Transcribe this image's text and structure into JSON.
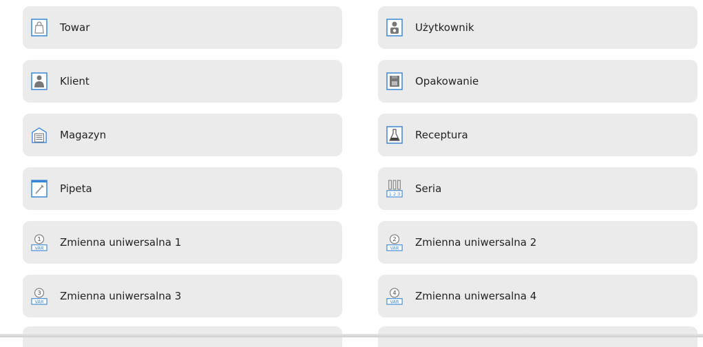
{
  "tiles": [
    {
      "label": "Towar",
      "icon": "shopping-bag-icon"
    },
    {
      "label": "Użytkownik",
      "icon": "user-icon"
    },
    {
      "label": "Klient",
      "icon": "client-icon"
    },
    {
      "label": "Opakowanie",
      "icon": "packaging-icon"
    },
    {
      "label": "Magazyn",
      "icon": "warehouse-icon"
    },
    {
      "label": "Receptura",
      "icon": "flask-icon"
    },
    {
      "label": "Pipeta",
      "icon": "pipette-icon"
    },
    {
      "label": "Seria",
      "icon": "series-icon"
    },
    {
      "label": "Zmienna uniwersalna 1",
      "icon": "variable-1-icon"
    },
    {
      "label": "Zmienna uniwersalna 2",
      "icon": "variable-2-icon"
    },
    {
      "label": "Zmienna uniwersalna 3",
      "icon": "variable-3-icon"
    },
    {
      "label": "Zmienna uniwersalna 4",
      "icon": "variable-4-icon"
    }
  ],
  "var_badge": "VAR",
  "var_numbers": [
    "1",
    "2",
    "3",
    "4"
  ],
  "series_digits": "1 2 3",
  "accent_color": "#3a86d4"
}
